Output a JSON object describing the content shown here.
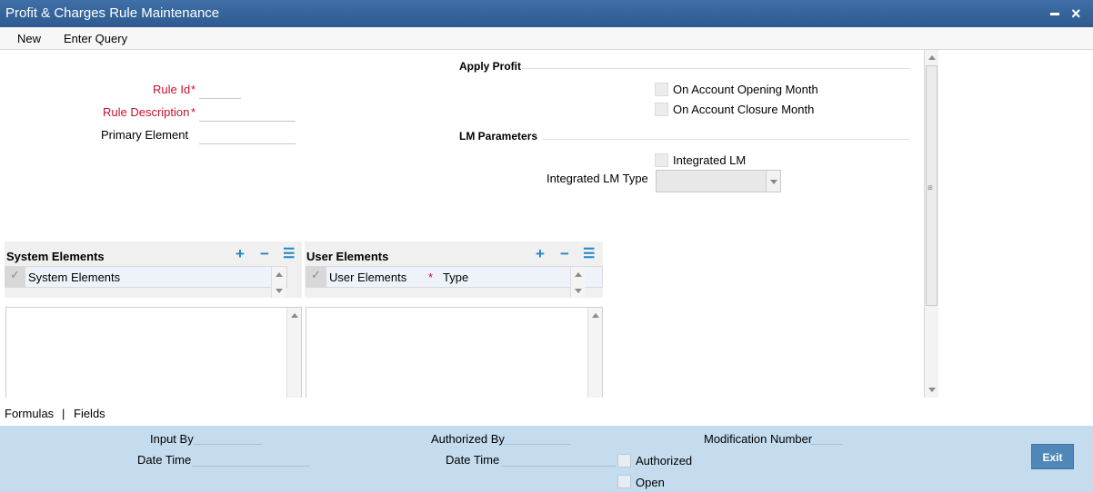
{
  "window": {
    "title": "Profit & Charges Rule Maintenance"
  },
  "menu": {
    "new": "New",
    "enter_query": "Enter Query"
  },
  "form": {
    "rule_id": {
      "label": "Rule Id",
      "required_mark": "*",
      "value": ""
    },
    "rule_description": {
      "label": "Rule Description",
      "required_mark": "*",
      "value": ""
    },
    "primary_element": {
      "label": "Primary Element",
      "value": ""
    }
  },
  "apply_profit": {
    "heading": "Apply Profit",
    "on_account_opening_month": "On Account Opening Month",
    "on_account_closure_month": "On Account Closure Month"
  },
  "lm_parameters": {
    "heading": "LM Parameters",
    "integrated_lm": "Integrated LM",
    "integrated_lm_type": {
      "label": "Integrated LM Type",
      "value": ""
    }
  },
  "system_elements": {
    "title": "System Elements",
    "column": "System Elements",
    "tools": {
      "add": "+",
      "remove": "−",
      "list": "☰"
    }
  },
  "user_elements": {
    "title": "User Elements",
    "column_1": "User Elements",
    "required_mark": "*",
    "column_2": "Type",
    "tools": {
      "add": "+",
      "remove": "−",
      "list": "☰"
    }
  },
  "tabs": {
    "formulas": "Formulas",
    "separator": "|",
    "fields": "Fields"
  },
  "footer": {
    "input_by": "Input By",
    "date_time_1": "Date Time",
    "authorized_by": "Authorized By",
    "date_time_2": "Date Time",
    "authorized": "Authorized",
    "open": "Open",
    "modification_number": "Modification Number",
    "exit": "Exit"
  },
  "colors": {
    "titlebar": "#2d5b91",
    "required": "#c8102e",
    "footer": "#c4dcee",
    "accent": "#1f86c9"
  }
}
